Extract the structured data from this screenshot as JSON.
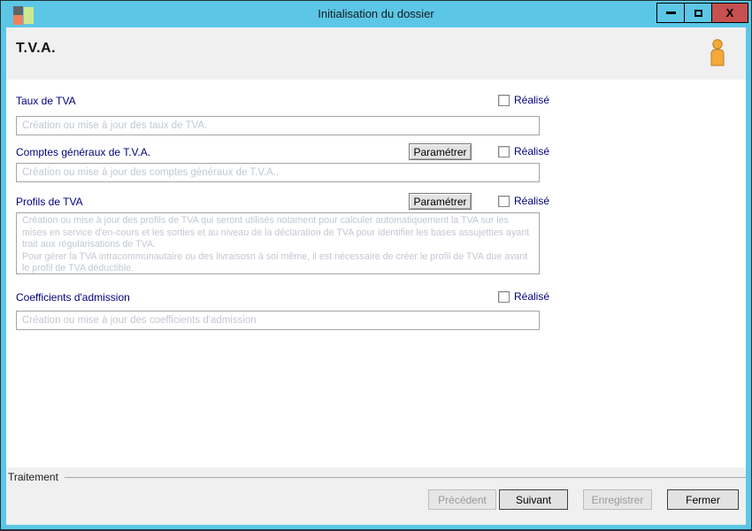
{
  "window": {
    "title": "Initialisation du dossier",
    "controls": [
      {
        "name": "minimize"
      },
      {
        "name": "maximize"
      },
      {
        "name": "close",
        "glyph": "X"
      }
    ]
  },
  "colors": {
    "titlebar_blue": "#5CC6E6",
    "close_red": "#C75050",
    "label_navy": "#00007D",
    "placeholder_gray": "#C2C8D2",
    "header_gray": "#F0F0F0"
  },
  "header": {
    "title": "T.V.A.",
    "icon": "user-icon"
  },
  "sections": [
    {
      "label": "Taux de TVA",
      "checkbox_label": "Réalisé",
      "checkbox_checked": false,
      "field_text": "Création ou mise à jour des taux de TVA."
    },
    {
      "label": "Comptes généraux de T.V.A.",
      "button_label": "Paramétrer",
      "checkbox_label": "Réalisé",
      "checkbox_checked": false,
      "field_text": "Création ou mise à jour des comptes généraux de T.V.A.."
    },
    {
      "label": "Profils de TVA",
      "button_label": "Paramétrer",
      "checkbox_label": "Réalisé",
      "checkbox_checked": false,
      "multiline": true,
      "field_text": "Création ou mise à jour des profils de TVA qui seront utilisés notament pour calculer automatiquement la TVA sur les mises en service d'en-cours et les sorties et au niveau de la déclaration de TVA pour identifier les bases assujetties ayant trait aux régularisations de TVA.\nPour gérer la TVA intracommunautaire ou des livraisosn à soi même, il est nécessaire de créer le profil de TVA due avant le profil de TVA déductible."
    },
    {
      "label": "Coefficients d'admission",
      "checkbox_label": "Réalisé",
      "checkbox_checked": false,
      "field_text": "Création ou mise à jour des coefficients d'admission"
    }
  ],
  "footer": {
    "group_label": "Traitement",
    "buttons": [
      {
        "label": "Précédent",
        "enabled": false
      },
      {
        "label": "Suivant",
        "enabled": true
      },
      {
        "label": "Enregistrer",
        "enabled": false
      },
      {
        "label": "Fermer",
        "enabled": true
      }
    ]
  }
}
